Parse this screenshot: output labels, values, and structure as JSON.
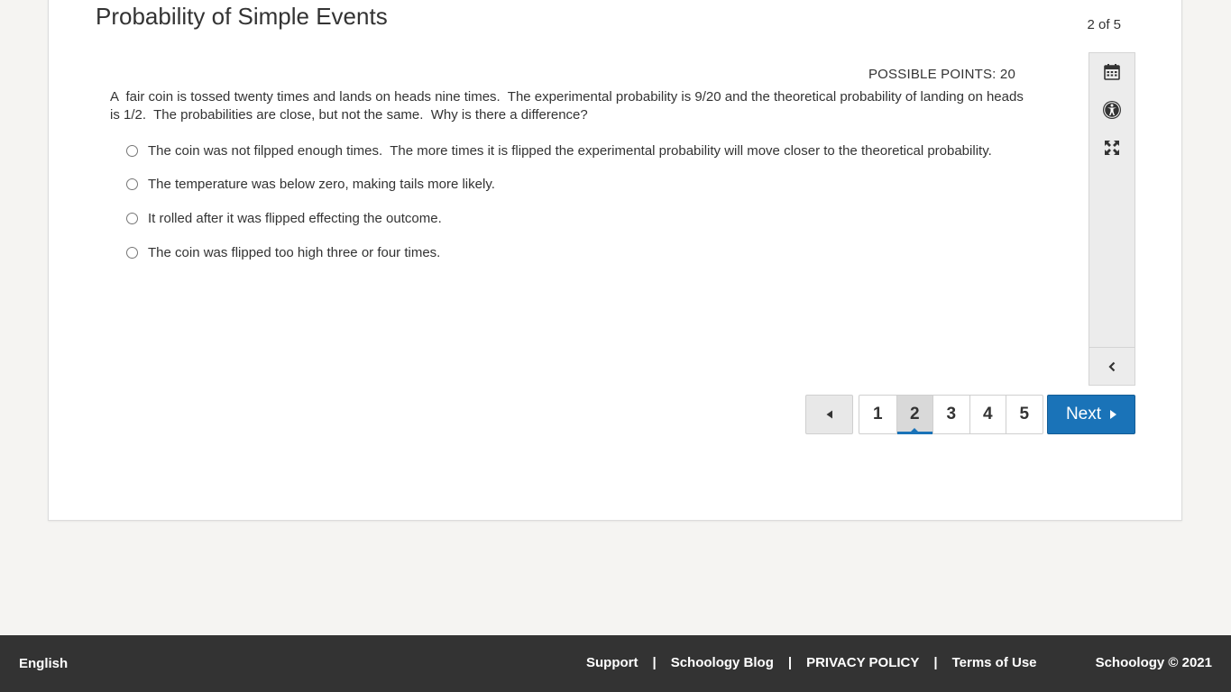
{
  "assessment": {
    "title": "Probability of Simple Events",
    "progress": "2 of 5",
    "possible_points": "POSSIBLE POINTS: 20"
  },
  "question": {
    "text": "A  fair coin is tossed twenty times and lands on heads nine times.  The experimental probability is 9/20 and the theoretical probability of landing on heads is 1/2.  The probabilities are close, but not the same.  Why is there a difference?",
    "answers": [
      "The coin was not filpped enough times.  The more times it is flipped the experimental probability will move closer to the theoretical probability.",
      "The temperature was below zero, making tails more likely.",
      "It rolled after it was flipped effecting the outcome.",
      "The coin was flipped too high three or four times."
    ],
    "selected": null
  },
  "tools": {
    "icons": [
      "calendar-icon",
      "accessibility-icon",
      "fullscreen-icon",
      "chevron-left-icon"
    ]
  },
  "pager": {
    "pages": [
      "1",
      "2",
      "3",
      "4",
      "5"
    ],
    "current_page": "2",
    "prev_icon": "triangle-left-icon",
    "next_label": "Next"
  },
  "footer": {
    "language": "English",
    "links": [
      "Support",
      "Schoology Blog",
      "PRIVACY POLICY",
      "Terms of Use"
    ],
    "separator": "|",
    "copyright": "Schoology © 2021"
  },
  "colors": {
    "accent": "#1a73b8",
    "footer_bg": "#333333",
    "page_bg": "#f5f4f2"
  }
}
